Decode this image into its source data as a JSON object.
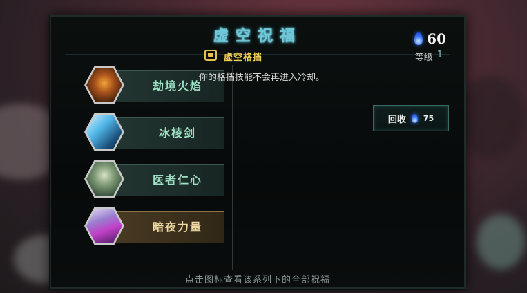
{
  "title": "虚空祝福",
  "currency": {
    "icon": "blue-soul-flame-icon",
    "value": "60"
  },
  "categories": [
    {
      "label": "劫境火焰",
      "icon": "fire-demon-icon",
      "active": false
    },
    {
      "label": "冰棱剑",
      "icon": "ice-sword-icon",
      "active": false
    },
    {
      "label": "医者仁心",
      "icon": "healer-hood-icon",
      "active": false
    },
    {
      "label": "暗夜力量",
      "icon": "night-power-icon",
      "active": true
    }
  ],
  "detail": {
    "icon": "parry-shield-icon",
    "name": "虚空格挡",
    "level_label": "等级",
    "level_value": "1",
    "description": "你的格挡技能不会再进入冷却。",
    "recycle": {
      "label": "回收",
      "icon": "blue-soul-flame-icon",
      "cost": "75"
    }
  },
  "footer": "点击图标查看该系列下的全部祝福",
  "colors": {
    "title": "#6fc7d8",
    "blessing_name": "#f2cf55",
    "category_text": "#9ee0c4",
    "active_text": "#f0d9a5"
  }
}
